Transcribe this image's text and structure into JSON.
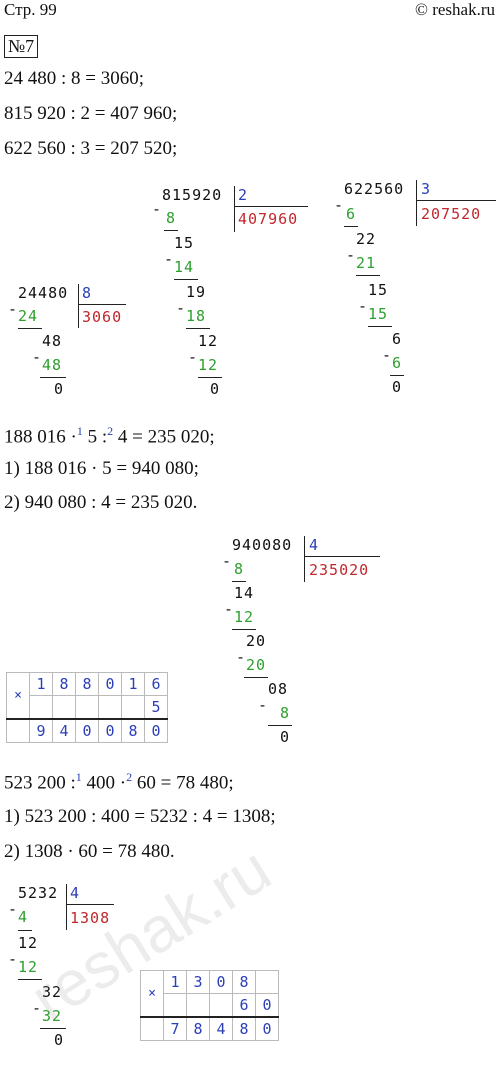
{
  "header": {
    "page": "Стр. 99",
    "site": "© reshak.ru"
  },
  "task_number": "№7",
  "part1": {
    "eq1": "24 480 : 8 = 3060;",
    "eq2": "815 920 : 2 = 407 960;",
    "eq3": "622 560 : 3 = 207 520;"
  },
  "div_815920": {
    "dividend": "815920",
    "divisor": "2",
    "quotient": "407960",
    "steps": [
      "8",
      "15",
      "14",
      "19",
      "18",
      "12",
      "12",
      "0"
    ]
  },
  "div_622560": {
    "dividend": "622560",
    "divisor": "3",
    "quotient": "207520",
    "steps": [
      "6",
      "22",
      "21",
      "15",
      "15",
      "6",
      "6",
      "0"
    ]
  },
  "div_24480": {
    "dividend": "24480",
    "divisor": "8",
    "quotient": "3060",
    "steps": [
      "24",
      "48",
      "48",
      "0"
    ]
  },
  "part2": {
    "expr_a": "188 016 ·",
    "sup1": "1",
    "expr_b": "5 :",
    "sup2": "2",
    "expr_c": "4 = 235 020;",
    "step1": "1) 188 016 · 5 = 940 080;",
    "step2": "2) 940 080 : 4 = 235 020."
  },
  "div_940080": {
    "dividend": "940080",
    "divisor": "4",
    "quotient": "235020",
    "steps": [
      "8",
      "14",
      "12",
      "20",
      "20",
      "08",
      "8",
      "0"
    ]
  },
  "mul_188016": {
    "sign": "×",
    "row1": [
      "1",
      "8",
      "8",
      "0",
      "1",
      "6"
    ],
    "row2": [
      "",
      "",
      "",
      "",
      "",
      "5"
    ],
    "row3": [
      "9",
      "4",
      "0",
      "0",
      "8",
      "0"
    ]
  },
  "part3": {
    "expr_a": "523 200 :",
    "sup1": "1",
    "expr_b": "400 ·",
    "sup2": "2",
    "expr_c": "60 = 78 480;",
    "step1": "1) 523 200 : 400 = 5232 : 4 = 1308;",
    "step2": "2) 1308 · 60 = 78 480."
  },
  "div_5232": {
    "dividend": "5232",
    "divisor": "4",
    "quotient": "1308",
    "steps": [
      "4",
      "12",
      "12",
      "32",
      "32",
      "0"
    ]
  },
  "mul_1308": {
    "sign": "×",
    "row1": [
      "1",
      "3",
      "0",
      "8",
      ""
    ],
    "row2": [
      "",
      "",
      "",
      "6",
      "0"
    ],
    "row3": [
      "7",
      "8",
      "4",
      "8",
      "0"
    ]
  },
  "watermark": "reshak.ru"
}
